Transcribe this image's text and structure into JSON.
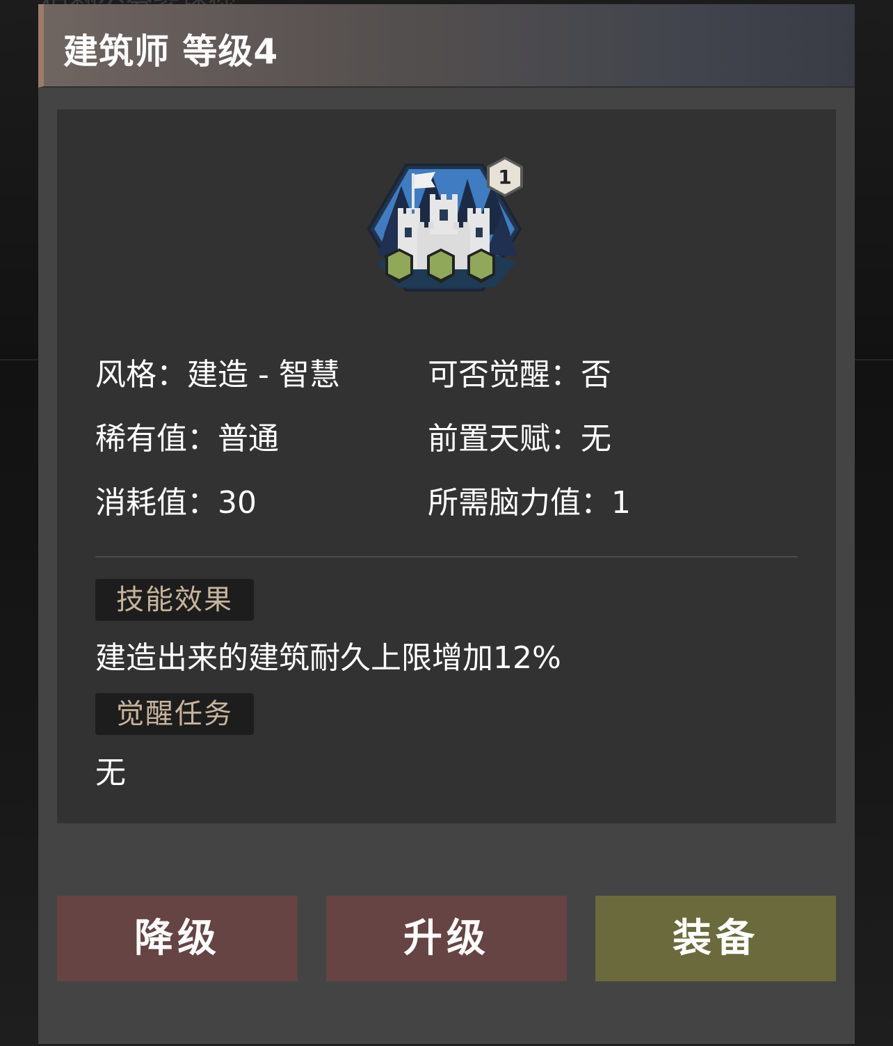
{
  "background": {
    "ghost_text": "佰翻公分紫播你"
  },
  "panel": {
    "title": "建筑师 等级4",
    "icon": {
      "name": "castle-skill-icon",
      "level_badge": "1",
      "slots_filled": 3,
      "slots_total": 3
    },
    "stats": {
      "style_label": "风格：",
      "style_value": "建造 - 智慧",
      "awaken_label": "可否觉醒：",
      "awaken_value": "否",
      "rarity_label": "稀有值：",
      "rarity_value": "普通",
      "prereq_label": "前置天赋：",
      "prereq_value": "无",
      "cost_label": "消耗值：",
      "cost_value": "30",
      "brain_label": "所需脑力值：",
      "brain_value": "1"
    },
    "effect": {
      "tag": "技能效果",
      "text": "建造出来的建筑耐久上限增加12%"
    },
    "awaken_task": {
      "tag": "觉醒任务",
      "text": "无"
    }
  },
  "buttons": {
    "downgrade": "降级",
    "upgrade": "升级",
    "equip": "装备"
  },
  "colors": {
    "downgrade_button": "#654443",
    "upgrade_button": "#654443",
    "equip_button": "#6a6a3c",
    "tag_text": "#c8b49c",
    "icon_hex_blue": "#3a74b8",
    "slot_green": "#8fa85a"
  }
}
